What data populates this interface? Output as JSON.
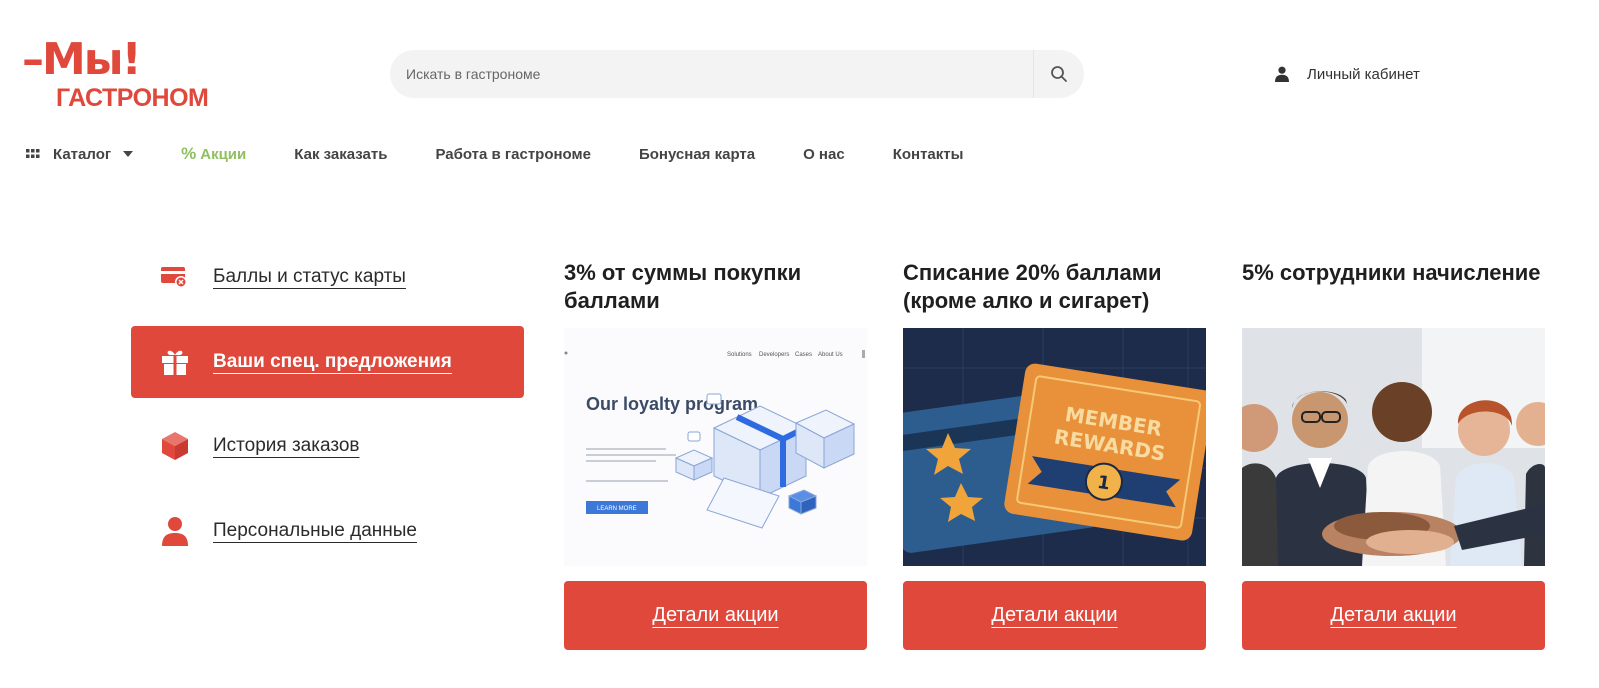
{
  "logo": {
    "line1": "–Мы!",
    "line2": "ГАСТРОНОМ"
  },
  "search": {
    "placeholder": "Искать в гастрономе",
    "icon": "search-icon"
  },
  "account": {
    "label": "Личный кабинет",
    "icon": "user-icon"
  },
  "nav": {
    "catalog": "Каталог",
    "promo": "Акции",
    "how_to_order": "Как заказать",
    "jobs": "Работа в гастрономе",
    "bonus_card": "Бонусная карта",
    "about": "О нас",
    "contacts": "Контакты"
  },
  "sidebar": {
    "items": [
      {
        "label": "Баллы и статус карты",
        "icon": "card-status-icon",
        "active": false
      },
      {
        "label": "Ваши спец. предложения",
        "icon": "gift-icon",
        "active": true
      },
      {
        "label": "История заказов",
        "icon": "box-icon",
        "active": false
      },
      {
        "label": "Персональные данные",
        "icon": "user-icon",
        "active": false
      }
    ]
  },
  "cards": [
    {
      "title": "3% от суммы покупки баллами",
      "image": {
        "heading": "Our loyalty program",
        "button": "LEARN MORE",
        "nav_items": [
          "Solutions",
          "Developers",
          "Cases",
          "About Us"
        ]
      },
      "button": "Детали акции"
    },
    {
      "title": "Списание 20% баллами (кроме алко и сигарет)",
      "image": {
        "line1": "MEMBER",
        "line2": "REWARDS",
        "badge": "1"
      },
      "button": "Детали акции"
    },
    {
      "title": "5% сотрудники начисление",
      "image": {
        "description": "photo"
      },
      "button": "Детали акции"
    }
  ],
  "colors": {
    "accent": "#e0483c",
    "promo_green": "#8fbf5f",
    "text": "#2b2b2b"
  }
}
